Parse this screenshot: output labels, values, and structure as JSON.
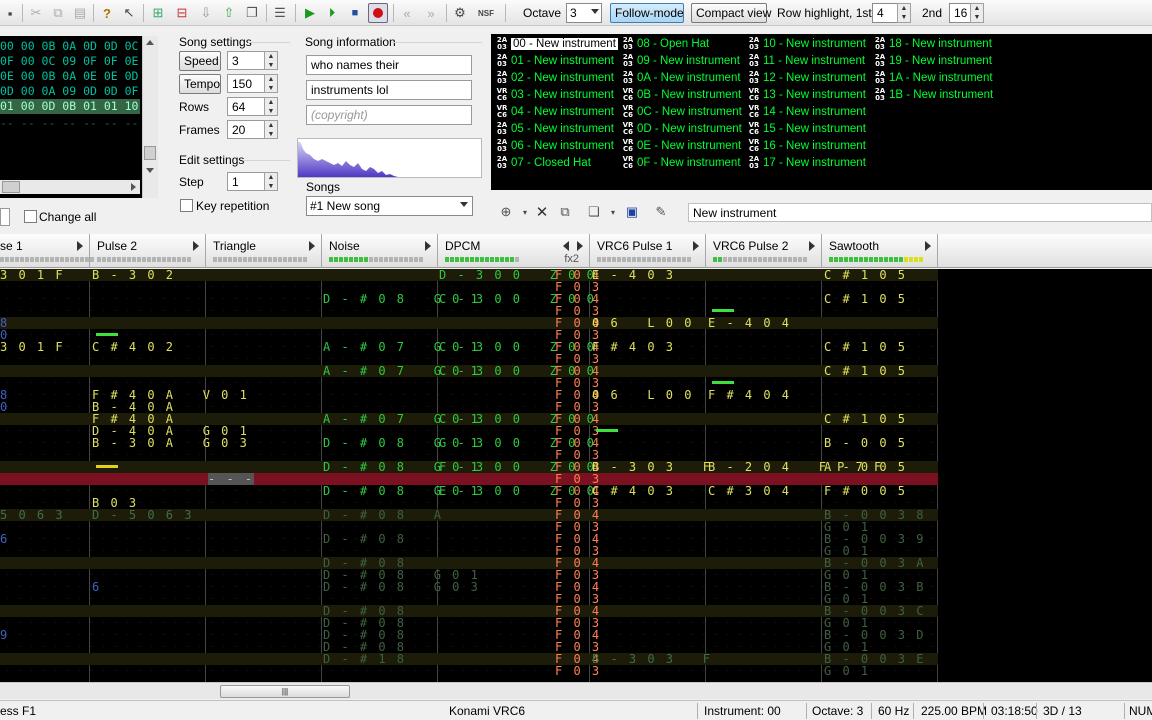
{
  "toolbar": {
    "octave_label": "Octave",
    "octave_value": "3",
    "follow_mode": "Follow-mode",
    "compact_view": "Compact view",
    "row_highlight_label": "Row highlight, 1st",
    "row_highlight_1st": "4",
    "second_label": "2nd",
    "row_highlight_2nd": "16"
  },
  "frames": {
    "rows": [
      "00 00 0B 0A 0D 0D 0C",
      "0F 00 0C 09 0F 0F 0E",
      "0E 00 0B 0A 0E 0E 0D",
      "0D 00 0A 09 0D 0D 0F",
      "01 00 0D 0B 01 01 10"
    ]
  },
  "song_settings": {
    "title": "Song settings",
    "speed_label": "Speed",
    "speed_value": "3",
    "tempo_label": "Tempo",
    "tempo_value": "150",
    "rows_label": "Rows",
    "rows_value": "64",
    "frames_label": "Frames",
    "frames_value": "20"
  },
  "edit_settings": {
    "title": "Edit settings",
    "step_label": "Step",
    "step_value": "1",
    "key_repetition": "Key repetition",
    "change_all": "Change all"
  },
  "song_info": {
    "title": "Song information",
    "name": "who names their",
    "artist": "instruments lol",
    "copyright_placeholder": "(copyright)",
    "songs_label": "Songs",
    "song_selected": "#1 New song"
  },
  "instruments": [
    {
      "id": "00",
      "name": "00 - New instrument",
      "chip": "2A03",
      "selected": true
    },
    {
      "id": "01",
      "name": "01 - New instrument",
      "chip": "2A03"
    },
    {
      "id": "02",
      "name": "02 - New instrument",
      "chip": "2A03"
    },
    {
      "id": "03",
      "name": "03 - New instrument",
      "chip": "VRC6"
    },
    {
      "id": "04",
      "name": "04 - New instrument",
      "chip": "VRC6"
    },
    {
      "id": "05",
      "name": "05 - New instrument",
      "chip": "2A03"
    },
    {
      "id": "06",
      "name": "06 - New instrument",
      "chip": "2A03"
    },
    {
      "id": "07",
      "name": "07 - Closed Hat",
      "chip": "2A03"
    },
    {
      "id": "08",
      "name": "08 - Open Hat",
      "chip": "2A03"
    },
    {
      "id": "09",
      "name": "09 - New instrument",
      "chip": "2A03"
    },
    {
      "id": "0A",
      "name": "0A - New instrument",
      "chip": "2A03"
    },
    {
      "id": "0B",
      "name": "0B - New instrument",
      "chip": "VRC6"
    },
    {
      "id": "0C",
      "name": "0C - New instrument",
      "chip": "VRC6"
    },
    {
      "id": "0D",
      "name": "0D - New instrument",
      "chip": "VRC6"
    },
    {
      "id": "0E",
      "name": "0E - New instrument",
      "chip": "VRC6"
    },
    {
      "id": "0F",
      "name": "0F - New instrument",
      "chip": "VRC6"
    },
    {
      "id": "10",
      "name": "10 - New instrument",
      "chip": "2A03"
    },
    {
      "id": "11",
      "name": "11 - New instrument",
      "chip": "2A03"
    },
    {
      "id": "12",
      "name": "12 - New instrument",
      "chip": "2A03"
    },
    {
      "id": "13",
      "name": "13 - New instrument",
      "chip": "VRC6"
    },
    {
      "id": "14",
      "name": "14 - New instrument",
      "chip": "VRC6"
    },
    {
      "id": "15",
      "name": "15 - New instrument",
      "chip": "VRC6"
    },
    {
      "id": "16",
      "name": "16 - New instrument",
      "chip": "VRC6"
    },
    {
      "id": "17",
      "name": "17 - New instrument",
      "chip": "2A03"
    },
    {
      "id": "18",
      "name": "18 - New instrument",
      "chip": "2A03"
    },
    {
      "id": "19",
      "name": "19 - New instrument",
      "chip": "2A03"
    },
    {
      "id": "1A",
      "name": "1A - New instrument",
      "chip": "2A03"
    },
    {
      "id": "1B",
      "name": "1B - New instrument",
      "chip": "2A03"
    }
  ],
  "instrument_name_field": "New instrument",
  "channels": [
    {
      "name": "Pulse 1",
      "display": "se 1"
    },
    {
      "name": "Pulse 2",
      "display": "Pulse 2"
    },
    {
      "name": "Triangle",
      "display": "Triangle"
    },
    {
      "name": "Noise",
      "display": "Noise"
    },
    {
      "name": "DPCM",
      "display": "DPCM",
      "fx": "fx2"
    },
    {
      "name": "VRC6 Pulse 1",
      "display": "VRC6 Pulse 1"
    },
    {
      "name": "VRC6 Pulse 2",
      "display": "VRC6 Pulse 2"
    },
    {
      "name": "Sawtooth",
      "display": "Sawtooth"
    }
  ],
  "pattern": {
    "rows": [
      {
        "p1": "3 0 1 F",
        "p2": "B - 3 0 2",
        "tri": "",
        "noi": "",
        "dpcm": "D - 3 0 0   Z 0 0",
        "fx": "F 0 4",
        "v1": "E - 4 0 3",
        "v2": "",
        "saw": "C # 1 0 5"
      },
      {
        "p1": "",
        "p2": "",
        "tri": "",
        "noi": "",
        "dpcm": "",
        "fx": "F 0 3",
        "v1": "",
        "v2": "",
        "saw": ""
      },
      {
        "p1": "",
        "p2": "",
        "tri": "",
        "noi": "D - # 0 8   G 0 1",
        "dpcm": "C - 3 0 0   Z 0 0",
        "fx": "F 0 4",
        "v1": "",
        "v2": "",
        "saw": "C # 1 0 5"
      },
      {
        "p1": "",
        "p2": "",
        "tri": "",
        "noi": "",
        "dpcm": "",
        "fx": "F 0 3",
        "v1": "",
        "v2": "",
        "saw": ""
      },
      {
        "p1": "8",
        "p2": "",
        "tri": "",
        "noi": "",
        "dpcm": "",
        "fx": "F 0 4",
        "v1": "0 6   L 0 0",
        "v2": "E - 4 0 4",
        "saw": ""
      },
      {
        "p1": "0",
        "p2": "",
        "tri": "",
        "noi": "",
        "dpcm": "",
        "fx": "F 0 3",
        "v1": "",
        "v2": "",
        "saw": ""
      },
      {
        "p1": "3 0 1 F",
        "p2": "C # 4 0 2",
        "tri": "",
        "noi": "A - # 0 7   G 0 1",
        "dpcm": "C - 3 0 0   Z 0 0",
        "fx": "F 0 4",
        "v1": "F # 4 0 3",
        "v2": "",
        "saw": "C # 1 0 5"
      },
      {
        "p1": "",
        "p2": "",
        "tri": "",
        "noi": "",
        "dpcm": "",
        "fx": "F 0 3",
        "v1": "",
        "v2": "",
        "saw": ""
      },
      {
        "p1": "",
        "p2": "",
        "tri": "",
        "noi": "A - # 0 7   G 0 1",
        "dpcm": "C - 3 0 0   Z 0 0",
        "fx": "F 0 4",
        "v1": "",
        "v2": "",
        "saw": "C # 1 0 5"
      },
      {
        "p1": "",
        "p2": "",
        "tri": "",
        "noi": "",
        "dpcm": "",
        "fx": "F 0 3",
        "v1": "",
        "v2": "",
        "saw": ""
      },
      {
        "p1": "8",
        "p2": "F # 4 0 A   V 0 1",
        "tri": "",
        "noi": "",
        "dpcm": "",
        "fx": "F 0 4",
        "v1": "0 6   L 0 0",
        "v2": "F # 4 0 4",
        "saw": ""
      },
      {
        "p1": "0",
        "p2": "B - 4 0 A",
        "tri": "",
        "noi": "",
        "dpcm": "",
        "fx": "F 0 3",
        "v1": "",
        "v2": "",
        "saw": ""
      },
      {
        "p1": "",
        "p2": "F # 4 0 A",
        "tri": "",
        "noi": "A - # 0 7   G 0 1",
        "dpcm": "C - 3 0 0   Z 0 0",
        "fx": "F 0 4",
        "v1": "",
        "v2": "",
        "saw": "C # 1 0 5"
      },
      {
        "p1": "",
        "p2": "D - 4 0 A   G 0 1",
        "tri": "",
        "noi": "",
        "dpcm": "",
        "fx": "F 0 3",
        "v1": "",
        "v2": "",
        "saw": ""
      },
      {
        "p1": "",
        "p2": "B - 3 0 A   G 0 3",
        "tri": "",
        "noi": "D - # 0 8   G 0 1",
        "dpcm": "G - 3 0 0   Z 0 0",
        "fx": "F 0 4",
        "v1": "",
        "v2": "",
        "saw": "B - 0 0 5"
      },
      {
        "p1": "",
        "p2": "",
        "tri": "",
        "noi": "",
        "dpcm": "",
        "fx": "F 0 3",
        "v1": "",
        "v2": "",
        "saw": ""
      },
      {
        "p1": "",
        "p2": "",
        "tri": "",
        "noi": "D - # 0 8   G 0 1",
        "dpcm": "F - 3 0 0   Z 0 0",
        "fx": "F 0 4",
        "v1": "B - 3 0 3   F",
        "v2": "B - 2 0 4   F P 7 F",
        "saw": "A - 0 0 5"
      },
      {
        "p1": "",
        "p2": "",
        "tri": "- - -",
        "noi": "",
        "dpcm": "",
        "fx": "F 0 3",
        "v1": "",
        "v2": "",
        "saw": ""
      },
      {
        "p1": "",
        "p2": "",
        "tri": "",
        "noi": "D - # 0 8   G 0 1",
        "dpcm": "E - 3 0 0   Z 0 0",
        "fx": "F 0 4",
        "v1": "C # 4 0 3",
        "v2": "C # 3 0 4",
        "saw": "F # 0 0 5"
      },
      {
        "p1": "",
        "p2": "B 0 3",
        "tri": "",
        "noi": "",
        "dpcm": "",
        "fx": "F 0 3",
        "v1": "",
        "v2": "",
        "saw": ""
      },
      {
        "p1": "5 0 6 3",
        "p2": "D - 5 0 6 3",
        "tri": "",
        "noi": "D - # 0 8   A",
        "dpcm": "",
        "fx": "F 0 4",
        "v1": "",
        "v2": "",
        "saw": "B - 0 0 3 8"
      },
      {
        "p1": "",
        "p2": "",
        "tri": "",
        "noi": "",
        "dpcm": "",
        "fx": "F 0 3",
        "v1": "",
        "v2": "",
        "saw": "G 0 1"
      },
      {
        "p1": "6",
        "p2": "",
        "tri": "",
        "noi": "D - # 0 8",
        "dpcm": "",
        "fx": "F 0 4",
        "v1": "",
        "v2": "",
        "saw": "B - 0 0 3 9"
      },
      {
        "p1": "",
        "p2": "",
        "tri": "",
        "noi": "",
        "dpcm": "",
        "fx": "F 0 3",
        "v1": "",
        "v2": "",
        "saw": "G 0 1"
      },
      {
        "p1": "",
        "p2": "",
        "tri": "",
        "noi": "D - # 0 8",
        "dpcm": "",
        "fx": "F 0 4",
        "v1": "",
        "v2": "",
        "saw": "B - 0 0 3 A"
      },
      {
        "p1": "",
        "p2": "",
        "tri": "",
        "noi": "D - # 0 8   G 0 1",
        "dpcm": "",
        "fx": "F 0 3",
        "v1": "",
        "v2": "",
        "saw": "G 0 1"
      },
      {
        "p1": "",
        "p2": "6",
        "tri": "",
        "noi": "D - # 0 8   G 0 3",
        "dpcm": "",
        "fx": "F 0 4",
        "v1": "",
        "v2": "",
        "saw": "B - 0 0 3 B"
      },
      {
        "p1": "",
        "p2": "",
        "tri": "",
        "noi": "",
        "dpcm": "",
        "fx": "F 0 3",
        "v1": "",
        "v2": "",
        "saw": "G 0 1"
      },
      {
        "p1": "",
        "p2": "",
        "tri": "",
        "noi": "D - # 0 8",
        "dpcm": "",
        "fx": "F 0 4",
        "v1": "",
        "v2": "",
        "saw": "B - 0 0 3 C"
      },
      {
        "p1": "",
        "p2": "",
        "tri": "",
        "noi": "D - # 0 8",
        "dpcm": "",
        "fx": "F 0 3",
        "v1": "",
        "v2": "",
        "saw": "G 0 1"
      },
      {
        "p1": "9",
        "p2": "",
        "tri": "",
        "noi": "D - # 0 8",
        "dpcm": "",
        "fx": "F 0 4",
        "v1": "",
        "v2": "",
        "saw": "B - 0 0 3 D"
      },
      {
        "p1": "",
        "p2": "",
        "tri": "",
        "noi": "D - # 0 8",
        "dpcm": "",
        "fx": "F 0 3",
        "v1": "",
        "v2": "",
        "saw": "G 0 1"
      },
      {
        "p1": "",
        "p2": "",
        "tri": "",
        "noi": "D - # 1 8",
        "dpcm": "",
        "fx": "F 0 4",
        "v1": "B - 3 0 3   F",
        "v2": "",
        "saw": "B - 0 0 3 E"
      },
      {
        "p1": "",
        "p2": "",
        "tri": "",
        "noi": "",
        "dpcm": "",
        "fx": "F 0 3",
        "v1": "",
        "v2": "",
        "saw": "G 0 1"
      }
    ]
  },
  "status": {
    "hint": "ess F1",
    "chip": "Konami VRC6",
    "instrument": "Instrument: 00",
    "octave": "Octave: 3",
    "rate": "60 Hz",
    "bpm": "225.00 BPM",
    "time": "03:18:50",
    "position": "3D / 13",
    "num": "NUM"
  },
  "colors": {
    "pattern_bg": "#000000",
    "note_yellow": "#e0e060",
    "note_green": "#30c840",
    "fx_orange": "#ff8050",
    "cursor_row": "#7a1020",
    "instrument_green": "#00ff30"
  }
}
